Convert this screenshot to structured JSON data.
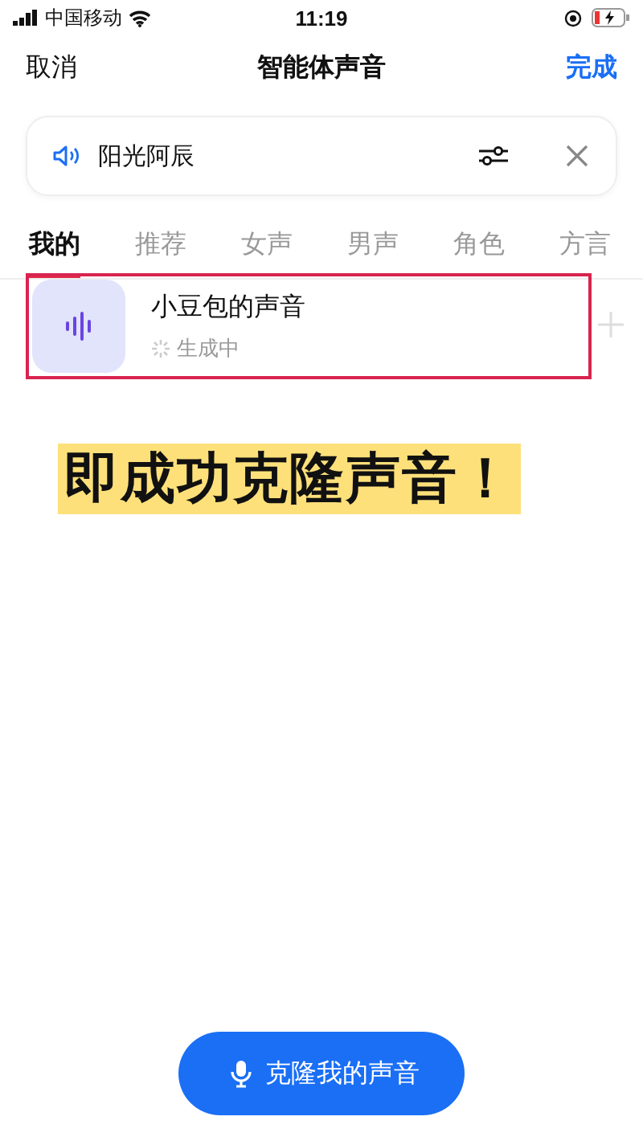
{
  "status_bar": {
    "carrier": "中国移动",
    "time": "11:19"
  },
  "nav": {
    "cancel": "取消",
    "title": "智能体声音",
    "done": "完成"
  },
  "voice_field": {
    "value": "阳光阿辰"
  },
  "tabs": [
    {
      "label": "我的",
      "selected": true
    },
    {
      "label": "推荐",
      "selected": false
    },
    {
      "label": "女声",
      "selected": false
    },
    {
      "label": "男声",
      "selected": false
    },
    {
      "label": "角色",
      "selected": false
    },
    {
      "label": "方言",
      "selected": false
    }
  ],
  "voices": [
    {
      "name": "小豆包的声音",
      "status": "生成中",
      "highlighted": true
    }
  ],
  "caption": "即成功克隆声音！",
  "clone_button": "克隆我的声音"
}
